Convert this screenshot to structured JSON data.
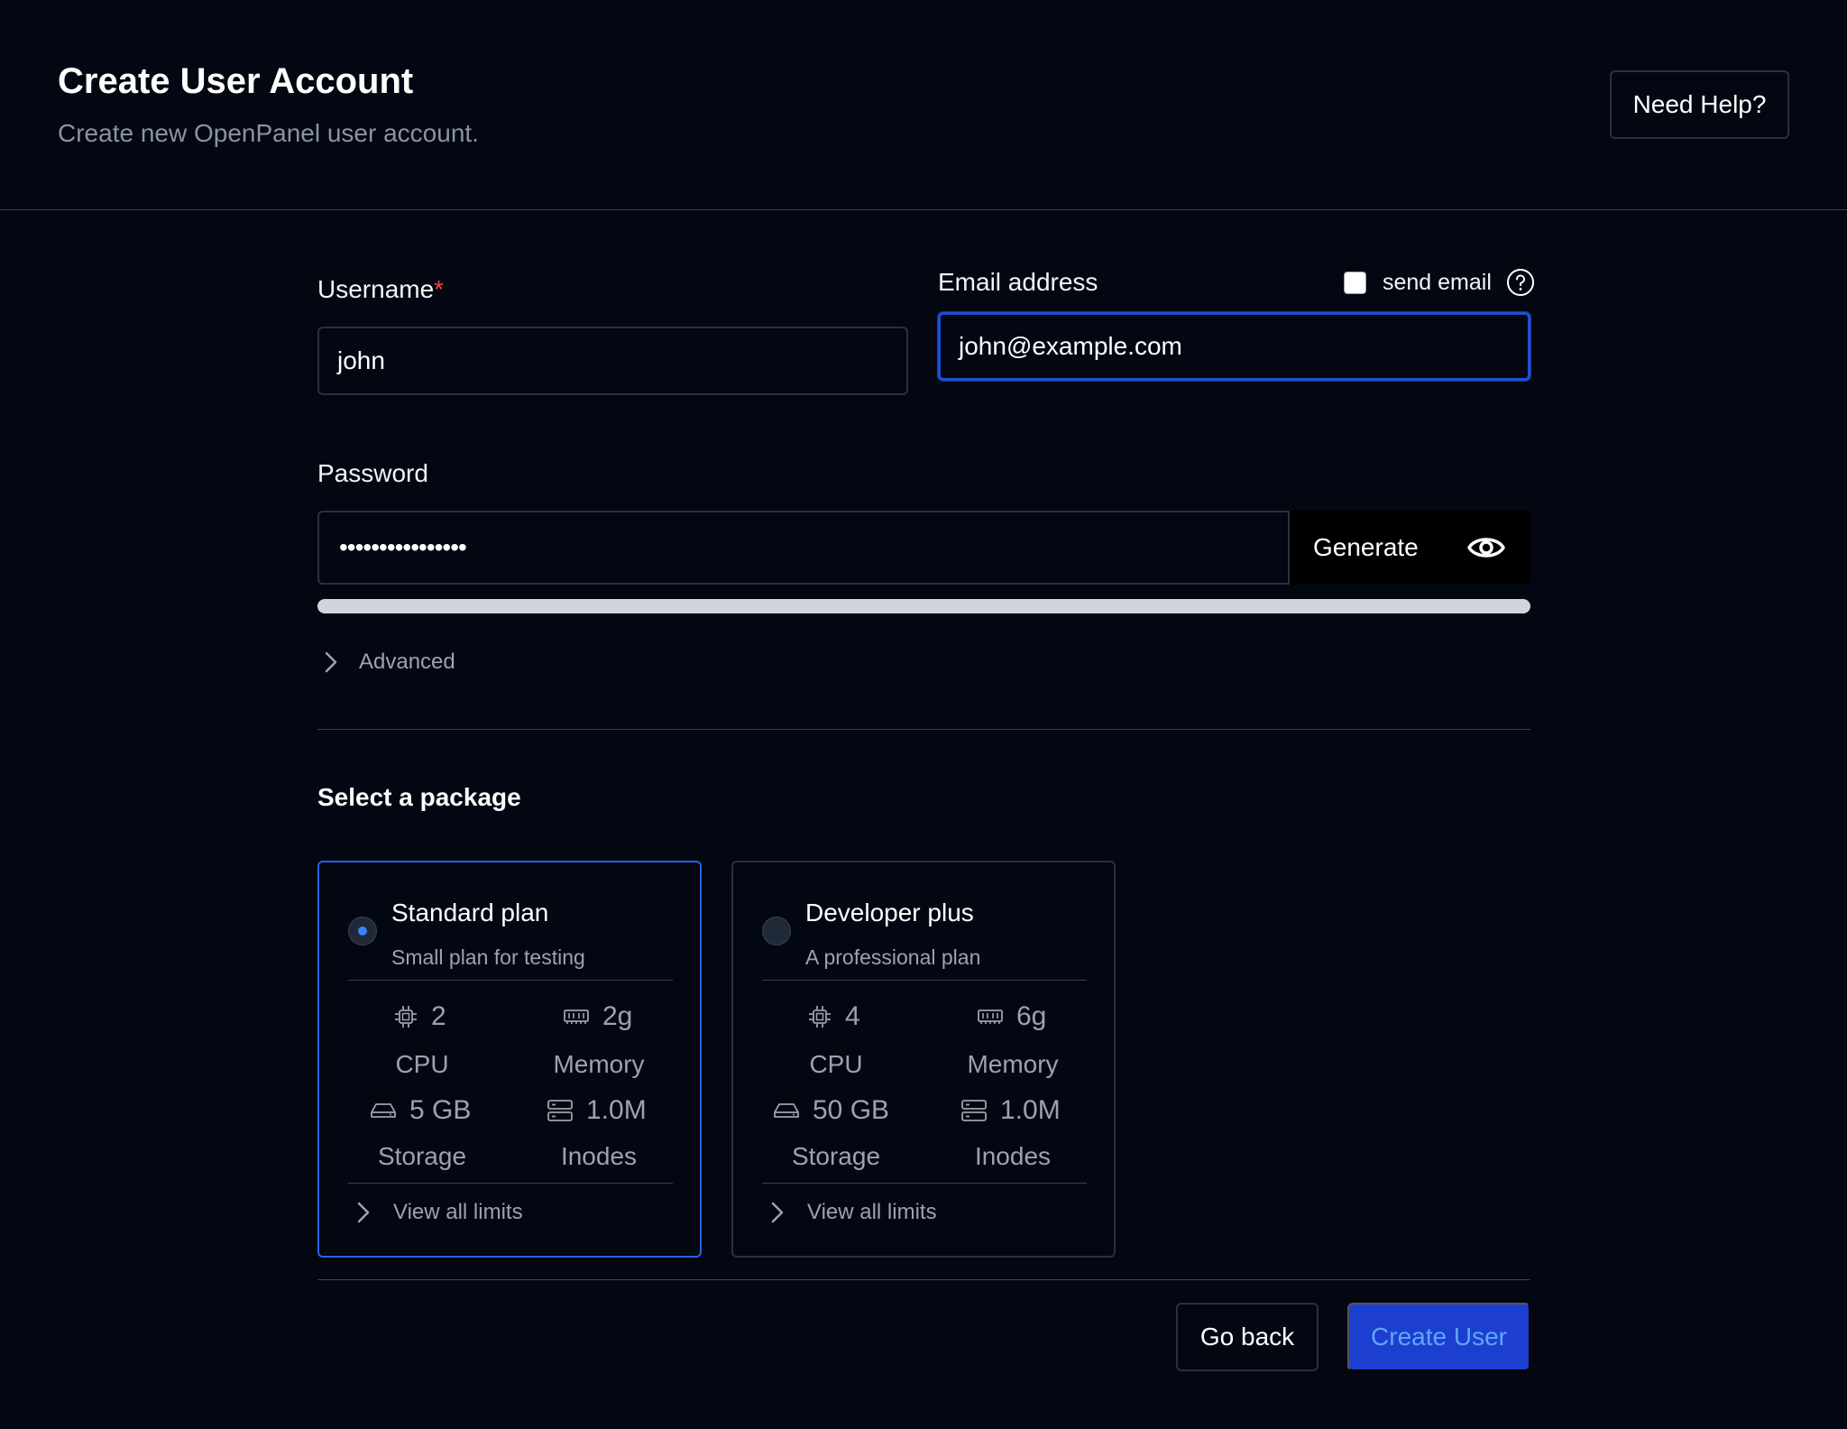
{
  "header": {
    "title": "Create User Account",
    "subtitle": "Create new OpenPanel user account.",
    "help_label": "Need Help?"
  },
  "form": {
    "username": {
      "label": "Username",
      "required_mark": "*",
      "value": "john"
    },
    "email": {
      "label": "Email address",
      "value": "john@example.com",
      "send_email_label": "send email",
      "send_email_checked": false
    },
    "password": {
      "label": "Password",
      "masked_value": "••••••••••••••••",
      "generate_label": "Generate"
    },
    "advanced_label": "Advanced"
  },
  "packages": {
    "title": "Select a package",
    "items": [
      {
        "name": "Standard plan",
        "description": "Small plan for testing",
        "selected": true,
        "cpu": "2",
        "cpu_label": "CPU",
        "memory": "2g",
        "memory_label": "Memory",
        "storage": "5 GB",
        "storage_label": "Storage",
        "inodes": "1.0M",
        "inodes_label": "Inodes",
        "limits_label": "View all limits"
      },
      {
        "name": "Developer plus",
        "description": "A professional plan",
        "selected": false,
        "cpu": "4",
        "cpu_label": "CPU",
        "memory": "6g",
        "memory_label": "Memory",
        "storage": "50 GB",
        "storage_label": "Storage",
        "inodes": "1.0M",
        "inodes_label": "Inodes",
        "limits_label": "View all limits"
      }
    ]
  },
  "actions": {
    "back_label": "Go back",
    "create_label": "Create User"
  },
  "colors": {
    "background": "#030712",
    "accent": "#2563eb",
    "primary_button": "#1d3fcf",
    "required": "#ef4444"
  }
}
